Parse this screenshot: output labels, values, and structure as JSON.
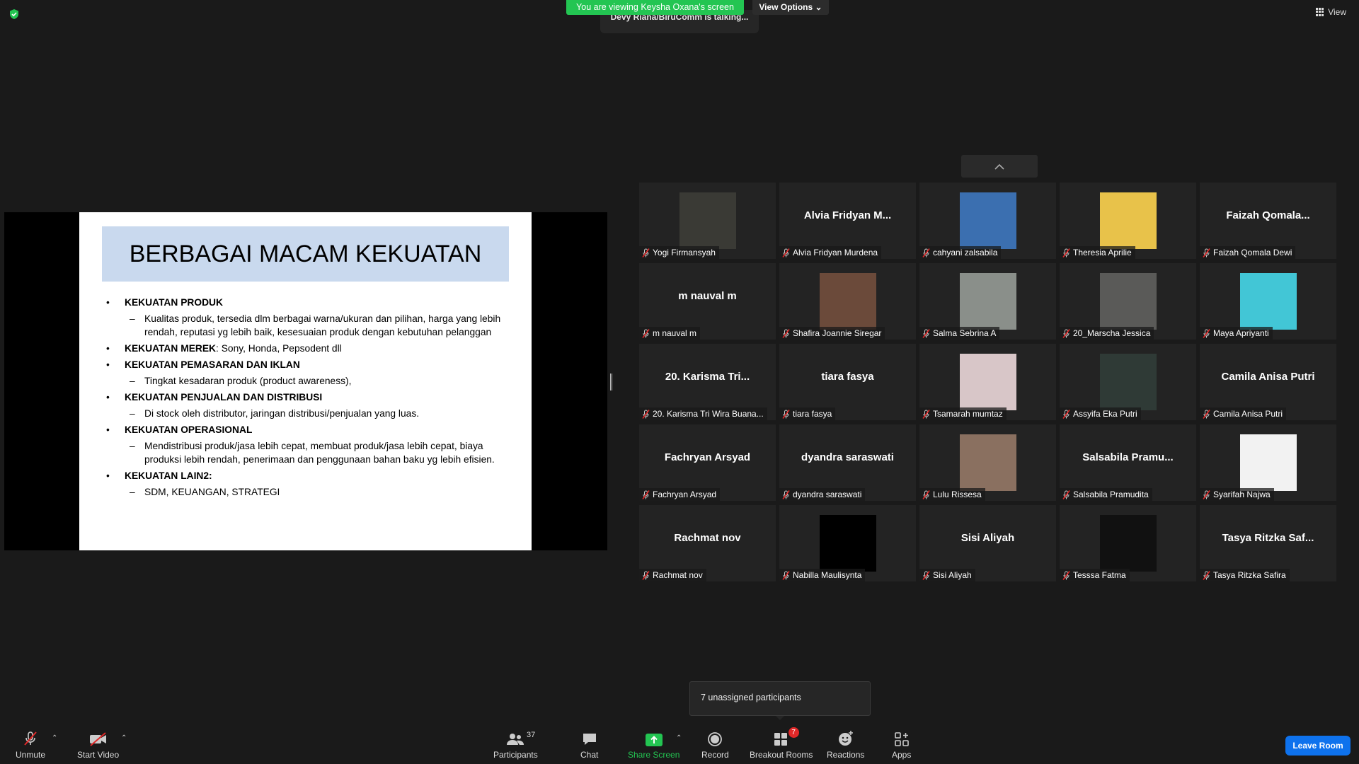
{
  "top": {
    "banner": "You are viewing Keysha Oxana's screen",
    "view_options": "View Options",
    "talking": "Devy Riana/BiruComm is talking...",
    "view": "View"
  },
  "slide": {
    "title": "BERBAGAI MACAM KEKUATAN",
    "items": [
      {
        "head": "KEKUATAN PRODUK",
        "tail": "",
        "sub": [
          "Kualitas produk, tersedia dlm berbagai warna/ukuran dan pilihan, harga yang lebih rendah, reputasi yg lebih baik, kesesuaian produk dengan kebutuhan pelanggan"
        ]
      },
      {
        "head": "KEKUATAN MEREK",
        "tail": ": Sony, Honda, Pepsodent dll",
        "sub": []
      },
      {
        "head": "KEKUATAN PEMASARAN DAN IKLAN",
        "tail": "",
        "sub": [
          "Tingkat kesadaran produk (product awareness),"
        ]
      },
      {
        "head": "KEKUATAN PENJUALAN DAN DISTRIBUSI",
        "tail": "",
        "sub": [
          "Di stock oleh distributor, jaringan distribusi/penjualan yang luas."
        ]
      },
      {
        "head": "KEKUATAN OPERASIONAL",
        "tail": "",
        "sub": [
          "Mendistribusi produk/jasa lebih cepat, membuat produk/jasa lebih cepat, biaya produksi lebih rendah, penerimaan dan penggunaan bahan baku yg lebih efisien."
        ]
      },
      {
        "head": "KEKUATAN LAIN2:",
        "tail": "",
        "sub": [
          "SDM, KEUANGAN, STRATEGI"
        ]
      }
    ]
  },
  "participants_grid": [
    {
      "display": "",
      "label": "Yogi Firmansyah",
      "photo": "#3a3a35"
    },
    {
      "display": "Alvia  Fridyan  M...",
      "label": "Alvia Fridyan Murdena",
      "photo": ""
    },
    {
      "display": "",
      "label": "cahyani zalsabila",
      "photo": "#3b6fb0"
    },
    {
      "display": "",
      "label": "Theresia Aprilie",
      "photo": "#e8c24a"
    },
    {
      "display": "Faizah  Qomala...",
      "label": "Faizah Qomala Dewi",
      "photo": ""
    },
    {
      "display": "m nauval m",
      "label": "m nauval m",
      "photo": ""
    },
    {
      "display": "",
      "label": "Shafira Joannie Siregar",
      "photo": "#6b4a3a"
    },
    {
      "display": "",
      "label": "Salma Sebrina A",
      "photo": "#8a8f8a"
    },
    {
      "display": "",
      "label": "20_Marscha Jessica",
      "photo": "#5a5a58"
    },
    {
      "display": "",
      "label": "Maya Apriyanti",
      "photo": "#42c6d6"
    },
    {
      "display": "20. Karisma Tri...",
      "label": "20. Karisma Tri Wira Buana...",
      "photo": ""
    },
    {
      "display": "tiara fasya",
      "label": "tiara fasya",
      "photo": ""
    },
    {
      "display": "",
      "label": "Tsamarah mumtaz",
      "photo": "#d8c6c8"
    },
    {
      "display": "",
      "label": "Assyifa Eka Putri",
      "photo": "#2f3a36"
    },
    {
      "display": "Camila Anisa Putri",
      "label": "Camila Anisa Putri",
      "photo": ""
    },
    {
      "display": "Fachryan Arsyad",
      "label": "Fachryan Arsyad",
      "photo": ""
    },
    {
      "display": "dyandra saraswati",
      "label": "dyandra saraswati",
      "photo": ""
    },
    {
      "display": "",
      "label": "Lulu Rissesa",
      "photo": "#8a7060"
    },
    {
      "display": "Salsabila  Pramu...",
      "label": "Salsabila Pramudita",
      "photo": ""
    },
    {
      "display": "",
      "label": "Syarifah Najwa",
      "photo": "#f2f2f2"
    },
    {
      "display": "Rachmat nov",
      "label": "Rachmat nov",
      "photo": ""
    },
    {
      "display": "",
      "label": "Nabilla Maulisynta",
      "photo": "#000000"
    },
    {
      "display": "Sisi Aliyah",
      "label": "Sisi Aliyah",
      "photo": ""
    },
    {
      "display": "",
      "label": "Tesssa Fatma",
      "photo": "#111111"
    },
    {
      "display": "Tasya  Ritzka  Saf...",
      "label": "Tasya Ritzka Safira",
      "photo": ""
    }
  ],
  "popover": "7 unassigned participants",
  "toolbar": {
    "unmute": "Unmute",
    "start_video": "Start Video",
    "participants": "Participants",
    "participants_count": "37",
    "chat": "Chat",
    "share_screen": "Share Screen",
    "record": "Record",
    "breakout_rooms": "Breakout Rooms",
    "breakout_badge": "7",
    "reactions": "Reactions",
    "apps": "Apps",
    "leave": "Leave Room"
  },
  "colors": {
    "share_green": "#23c552",
    "leave_blue": "#0e72ed",
    "muted_red": "#e02828"
  }
}
